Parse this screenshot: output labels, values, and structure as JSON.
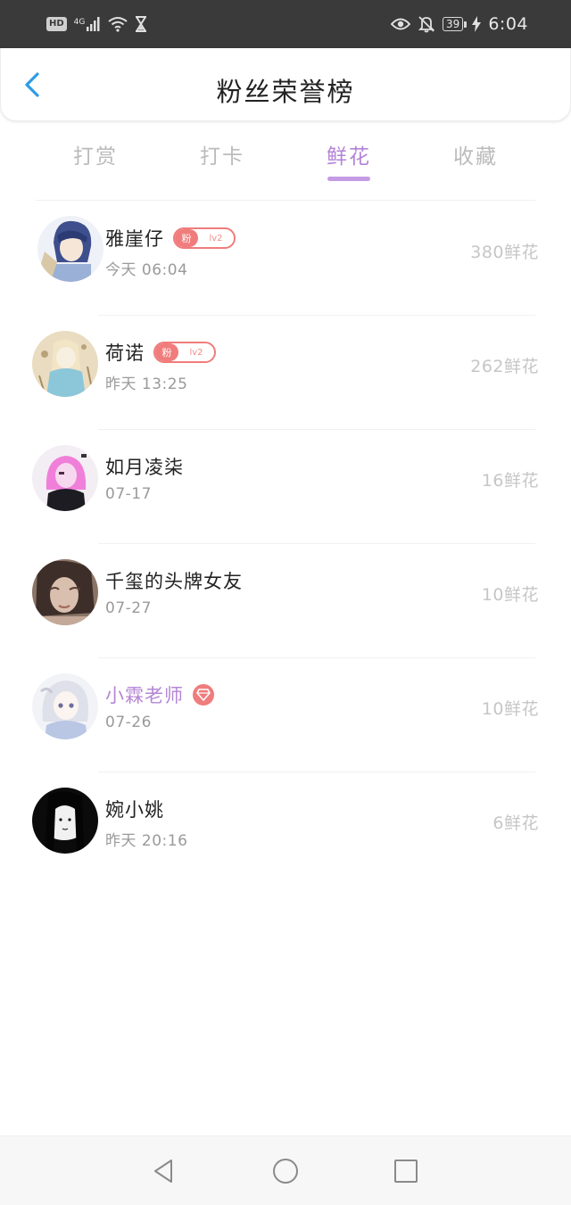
{
  "status_bar": {
    "hd_label": "HD",
    "network_label": "4G",
    "battery_level": "39",
    "time": "6:04",
    "icons": [
      "signal-icon",
      "wifi-icon",
      "hourglass-icon",
      "eye-icon",
      "bell-off-icon",
      "battery-icon",
      "charging-icon"
    ]
  },
  "header": {
    "title": "粉丝荣誉榜",
    "back_icon": "chevron-left-icon",
    "accent_color": "#2f9be6"
  },
  "tabs": [
    {
      "label": "打赏",
      "active": false
    },
    {
      "label": "打卡",
      "active": false
    },
    {
      "label": "鲜花",
      "active": true
    },
    {
      "label": "收藏",
      "active": false
    }
  ],
  "accent_color": "#b483d8",
  "fans": [
    {
      "name": "雅崖仔",
      "badge_fan": "粉",
      "badge_level": "lv2",
      "time": "今天 06:04",
      "amount": "380鲜花"
    },
    {
      "name": "荷诺",
      "badge_fan": "粉",
      "badge_level": "lv2",
      "time": "昨天 13:25",
      "amount": "262鲜花"
    },
    {
      "name": "如月凌柒",
      "time": "07-17",
      "amount": "16鲜花"
    },
    {
      "name": "千玺的头牌女友",
      "time": "07-27",
      "amount": "10鲜花"
    },
    {
      "name": "小霖老师",
      "vip": true,
      "time": "07-26",
      "amount": "10鲜花"
    },
    {
      "name": "婉小姚",
      "time": "昨天 20:16",
      "amount": "6鲜花"
    }
  ],
  "navbar": {
    "icons": [
      "back-triangle-icon",
      "home-circle-icon",
      "recents-square-icon"
    ]
  }
}
